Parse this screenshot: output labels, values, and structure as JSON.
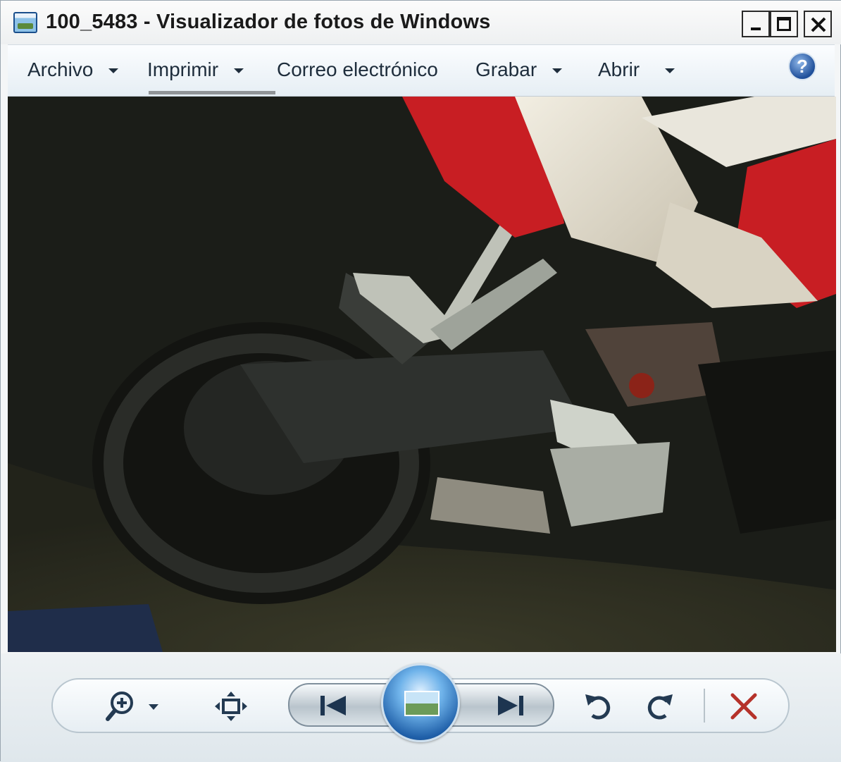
{
  "window": {
    "title": "100_5483 - Visualizador de fotos de Windows"
  },
  "menu": {
    "items": [
      {
        "label": "Archivo",
        "has_dropdown": true
      },
      {
        "label": "Imprimir",
        "has_dropdown": true
      },
      {
        "label": "Correo electrónico",
        "has_dropdown": false
      },
      {
        "label": "Grabar",
        "has_dropdown": true
      },
      {
        "label": "Abrir",
        "has_dropdown": true
      }
    ],
    "help_glyph": "?"
  },
  "photo": {
    "subject": "motorcycle-close-up",
    "colors": {
      "red_fairing": "#c81e23",
      "white_fairing": "#e2dccd",
      "ground": "#2c2d20"
    }
  },
  "toolbar": {
    "icons": [
      "zoom-icon",
      "fit-to-window-icon",
      "previous-icon",
      "slideshow-icon",
      "next-icon",
      "rotate-counterclockwise-icon",
      "rotate-clockwise-icon",
      "delete-icon"
    ],
    "delete_color": "#b5322a"
  }
}
